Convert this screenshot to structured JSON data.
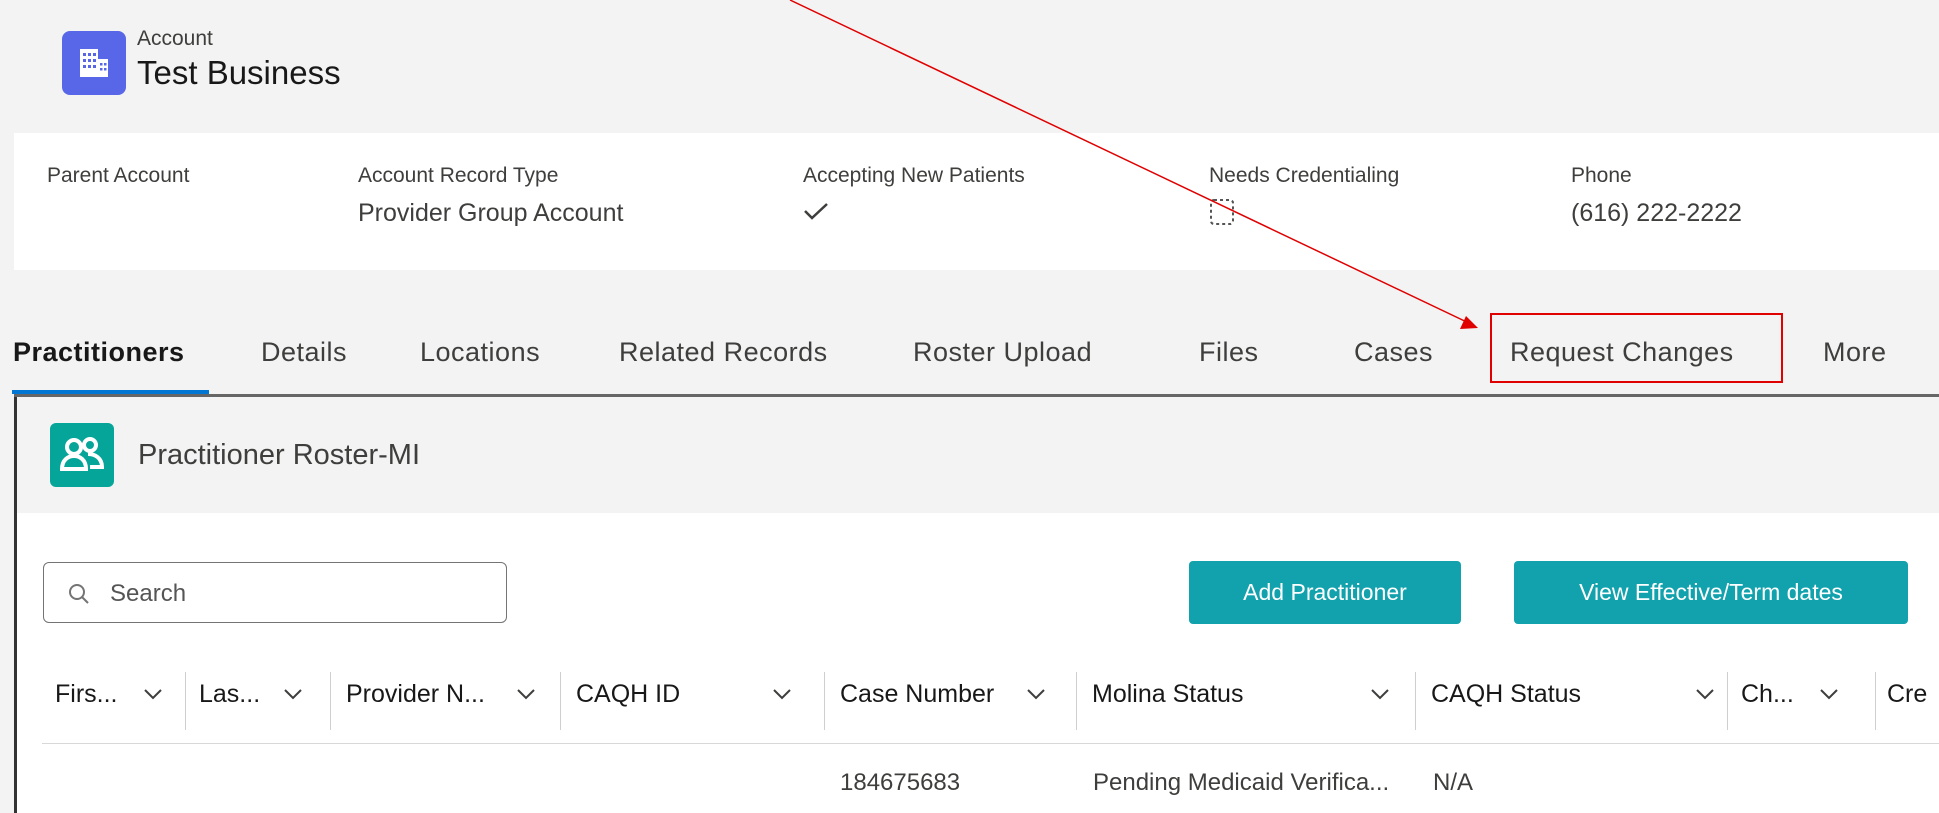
{
  "header": {
    "object_label": "Account",
    "record_name": "Test Business",
    "icon": "account-building-icon"
  },
  "highlights": {
    "fields": [
      {
        "label": "Parent Account",
        "value": ""
      },
      {
        "label": "Account Record Type",
        "value": "Provider Group Account"
      },
      {
        "label": "Accepting New Patients",
        "value": "✓"
      },
      {
        "label": "Needs Credentialing",
        "value": ""
      },
      {
        "label": "Phone",
        "value": "(616) 222-2222"
      }
    ],
    "accepting_new_patients_checked": true,
    "needs_credentialing_checked": false
  },
  "tabs": {
    "items": [
      "Practitioners",
      "Details",
      "Locations",
      "Related Records",
      "Roster Upload",
      "Files",
      "Cases",
      "Request Changes",
      "More"
    ],
    "active": "Practitioners"
  },
  "roster": {
    "title": "Practitioner Roster-MI",
    "icon": "people-group-icon",
    "search_placeholder": "Search",
    "add_button": "Add Practitioner",
    "view_dates_button": "View Effective/Term dates",
    "columns": [
      "Firs...",
      "Las...",
      "Provider N...",
      "CAQH ID",
      "Case Number",
      "Molina Status",
      "CAQH Status",
      "Ch...",
      "Cre"
    ],
    "rows": [
      {
        "first": "",
        "last": "",
        "provider_name": "",
        "caqh_id": "",
        "case_number": "184675683",
        "molina_status": "Pending Medicaid Verifica...",
        "caqh_status": "N/A"
      }
    ]
  },
  "colors": {
    "account_icon": "#5867e8",
    "roster_icon": "#06a59a",
    "button": "#12a2ad",
    "active_tab_underline": "#0176d3",
    "annotation": "#e00000"
  }
}
